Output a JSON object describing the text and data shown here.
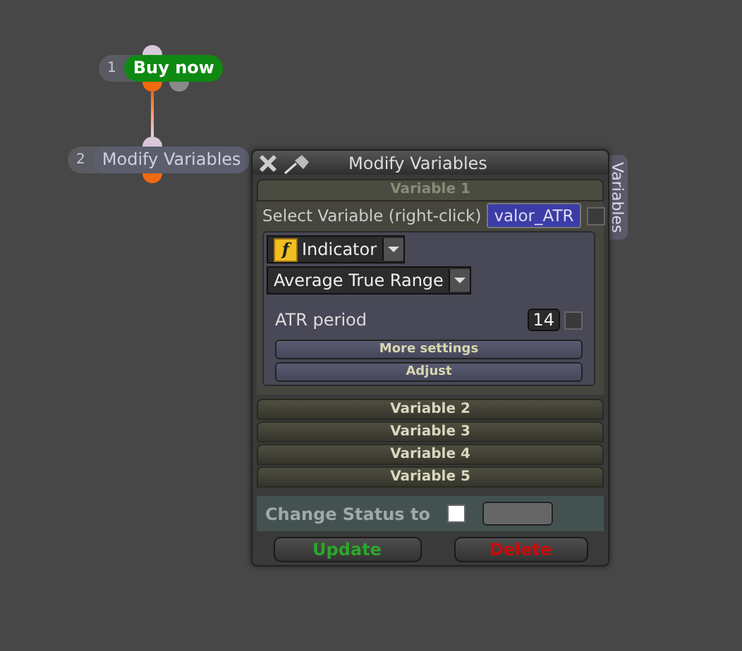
{
  "nodes": [
    {
      "number": "1",
      "label": "Buy now",
      "kind": "action"
    },
    {
      "number": "2",
      "label": "Modify Variables",
      "kind": "plain"
    }
  ],
  "panel": {
    "title": "Modify Variables",
    "side_tab": "Variables",
    "sections": [
      {
        "title": "Variable 1",
        "expanded": true
      },
      {
        "title": "Variable 2",
        "expanded": false
      },
      {
        "title": "Variable 3",
        "expanded": false
      },
      {
        "title": "Variable 4",
        "expanded": false
      },
      {
        "title": "Variable 5",
        "expanded": false
      }
    ],
    "select_label": "Select Variable (right-click)",
    "variable_name": "valor_ATR",
    "variable_checked": false,
    "type_icon": "f",
    "type": "Indicator",
    "indicator": "Average True Range",
    "params": [
      {
        "label": "ATR period",
        "value": "14",
        "checked": false
      }
    ],
    "sub_buttons": [
      "More settings",
      "Adjust"
    ],
    "status": {
      "label": "Change Status to",
      "checked": false
    },
    "buttons": [
      {
        "label": "Update",
        "kind": "update"
      },
      {
        "label": "Delete",
        "kind": "delete"
      }
    ]
  }
}
